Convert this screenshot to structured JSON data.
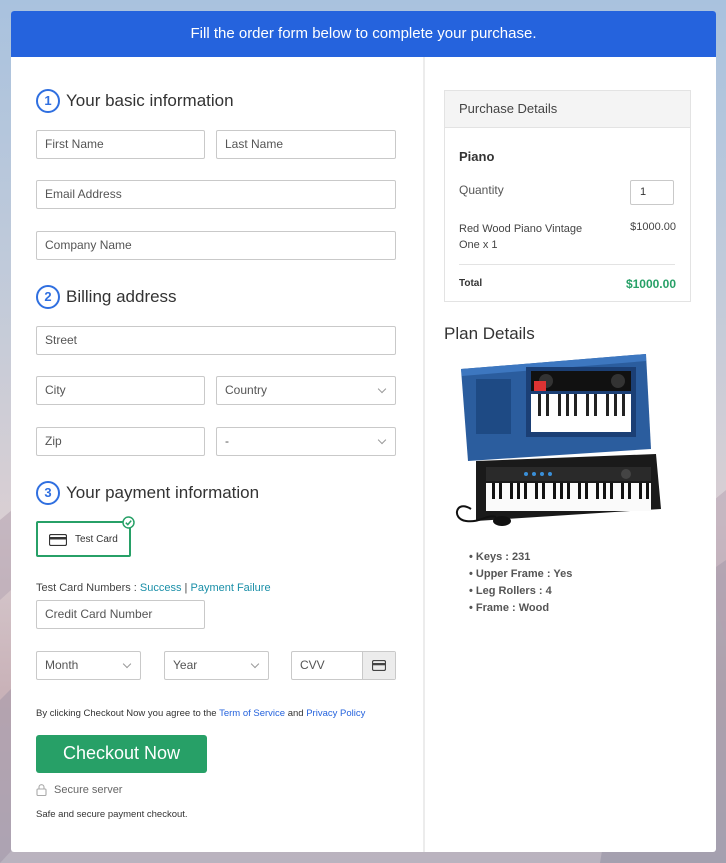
{
  "banner": {
    "text": "Fill the order form below to complete your purchase."
  },
  "sections": [
    {
      "num": "1",
      "title": "Your basic information"
    },
    {
      "num": "2",
      "title": "Billing address"
    },
    {
      "num": "3",
      "title": "Your payment information"
    }
  ],
  "fields": {
    "first_name": "First Name",
    "last_name": "Last Name",
    "email": "Email Address",
    "company": "Company Name",
    "street": "Street",
    "city": "City",
    "country": "Country",
    "zip": "Zip",
    "state": "-",
    "card_number": "Credit Card Number",
    "month": "Month",
    "year": "Year",
    "cvv": "CVV"
  },
  "payment": {
    "method_label": "Test Card",
    "test_numbers_label": "Test Card Numbers : ",
    "success_link": "Success",
    "separator": " | ",
    "failure_link": "Payment Failure"
  },
  "terms": {
    "prefix": "By clicking Checkout Now you agree to the ",
    "tos": "Term of Service",
    "and": " and ",
    "privacy": "Privacy Policy"
  },
  "checkout": {
    "label": "Checkout Now"
  },
  "secure": {
    "label": "Secure server",
    "note": "Safe and secure payment checkout."
  },
  "purchase": {
    "header": "Purchase Details",
    "product": "Piano",
    "quantity_label": "Quantity",
    "quantity_value": "1",
    "item_name_line1": "Red Wood Piano Vintage",
    "item_name_line2": "One x 1",
    "item_price": "$1000.00",
    "total_label": "Total",
    "total_value": "$1000.00"
  },
  "plan": {
    "title": "Plan Details",
    "features": [
      "Keys : 231",
      "Upper Frame : Yes",
      "Leg Rollers : 4",
      "Frame : Wood"
    ]
  },
  "colors": {
    "accent": "#2563dd",
    "checkout": "#27a067",
    "total": "#27a067",
    "link": "#1a8fa8"
  }
}
